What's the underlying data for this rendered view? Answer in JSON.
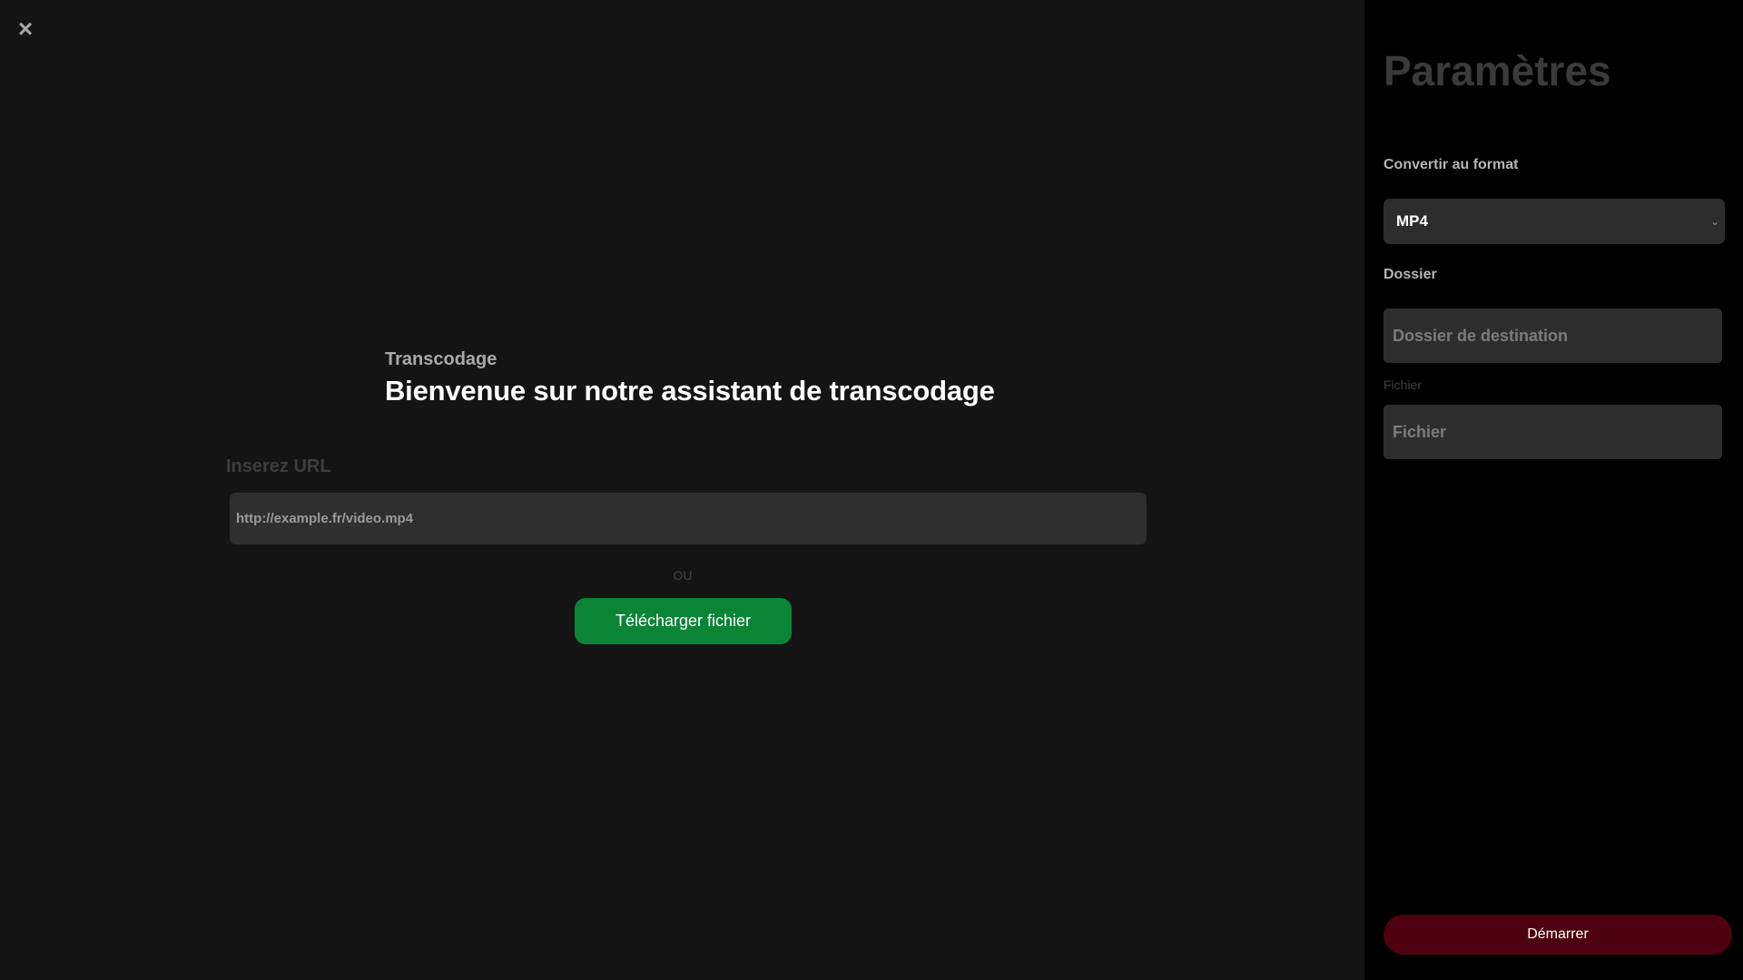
{
  "main": {
    "close_icon": "×",
    "eyebrow": "Transcodage",
    "headline": "Bienvenue sur notre assistant de transcodage",
    "url_label": "Inserez URL",
    "url_input": {
      "value": "",
      "placeholder": "http://example.fr/video.mp4"
    },
    "or_text": "OU",
    "upload_button": "Télécharger fichier"
  },
  "sidebar": {
    "title": "Paramètres",
    "format_label": "Convertir au format",
    "format_selected": "MP4",
    "chevron_icon": "⌄",
    "folder_label": "Dossier",
    "folder_input": {
      "value": "",
      "placeholder": "Dossier de destination"
    },
    "file_label": "Fichier",
    "file_input": {
      "value": "",
      "placeholder": "Fichier"
    },
    "start_button": "Démarrer"
  },
  "colors": {
    "main_background": "#141414",
    "sidebar_background": "#000000",
    "upload_button": "#0b8436",
    "start_button": "#4d0110",
    "input_background": "#2d2d2d"
  },
  "icons": {
    "close": "close-icon",
    "dropdown": "chevron-down-icon"
  }
}
